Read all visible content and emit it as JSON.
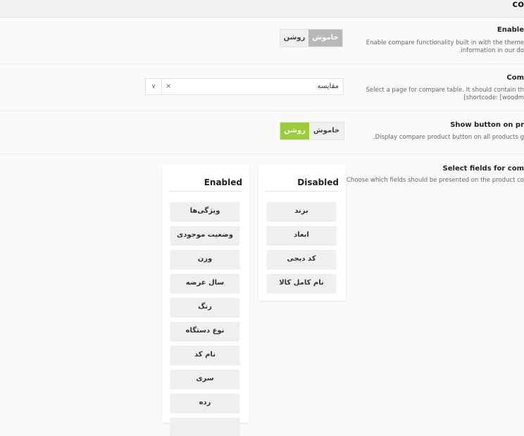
{
  "header": {
    "title": "co"
  },
  "settings": {
    "enable_compare": {
      "label": "Enable",
      "desc_line1": "Enable compare functionality built in with the theme",
      "desc_line2": ".information in our do",
      "toggle_on": "روشن",
      "toggle_off": "خاموش",
      "selected": "off"
    },
    "compare_page": {
      "label": "Com",
      "desc_line1": "Select a page for compare table. It should contain th",
      "desc_line2": "[shortcode: [woodm",
      "selected_value": "مقایسه",
      "clear_symbol": "×",
      "arrow_symbol": "∨"
    },
    "show_button": {
      "label": "Show button on pr",
      "desc": ".Display compare product button on all products g",
      "toggle_on": "روشن",
      "toggle_off": "خاموش",
      "selected": "on"
    },
    "fields": {
      "label": "Select fields for com",
      "desc": "Choose which fields should be presented on the product co",
      "disabled_title": "Disabled",
      "enabled_title": "Enabled",
      "disabled_items": [
        "برند",
        "ابعاد",
        "کد دیجی",
        "نام کامل کالا"
      ],
      "enabled_items": [
        "ویژگی‌ها",
        "وضعیت موجودی",
        "وزن",
        "سال عرضه",
        "رنگ",
        "نوع دستگاه",
        "نام کد",
        "سری",
        "رده",
        ""
      ]
    }
  },
  "colors": {
    "active_gray": "#b8b8b8",
    "active_green": "#9ccb3c",
    "inactive": "#efefef"
  }
}
